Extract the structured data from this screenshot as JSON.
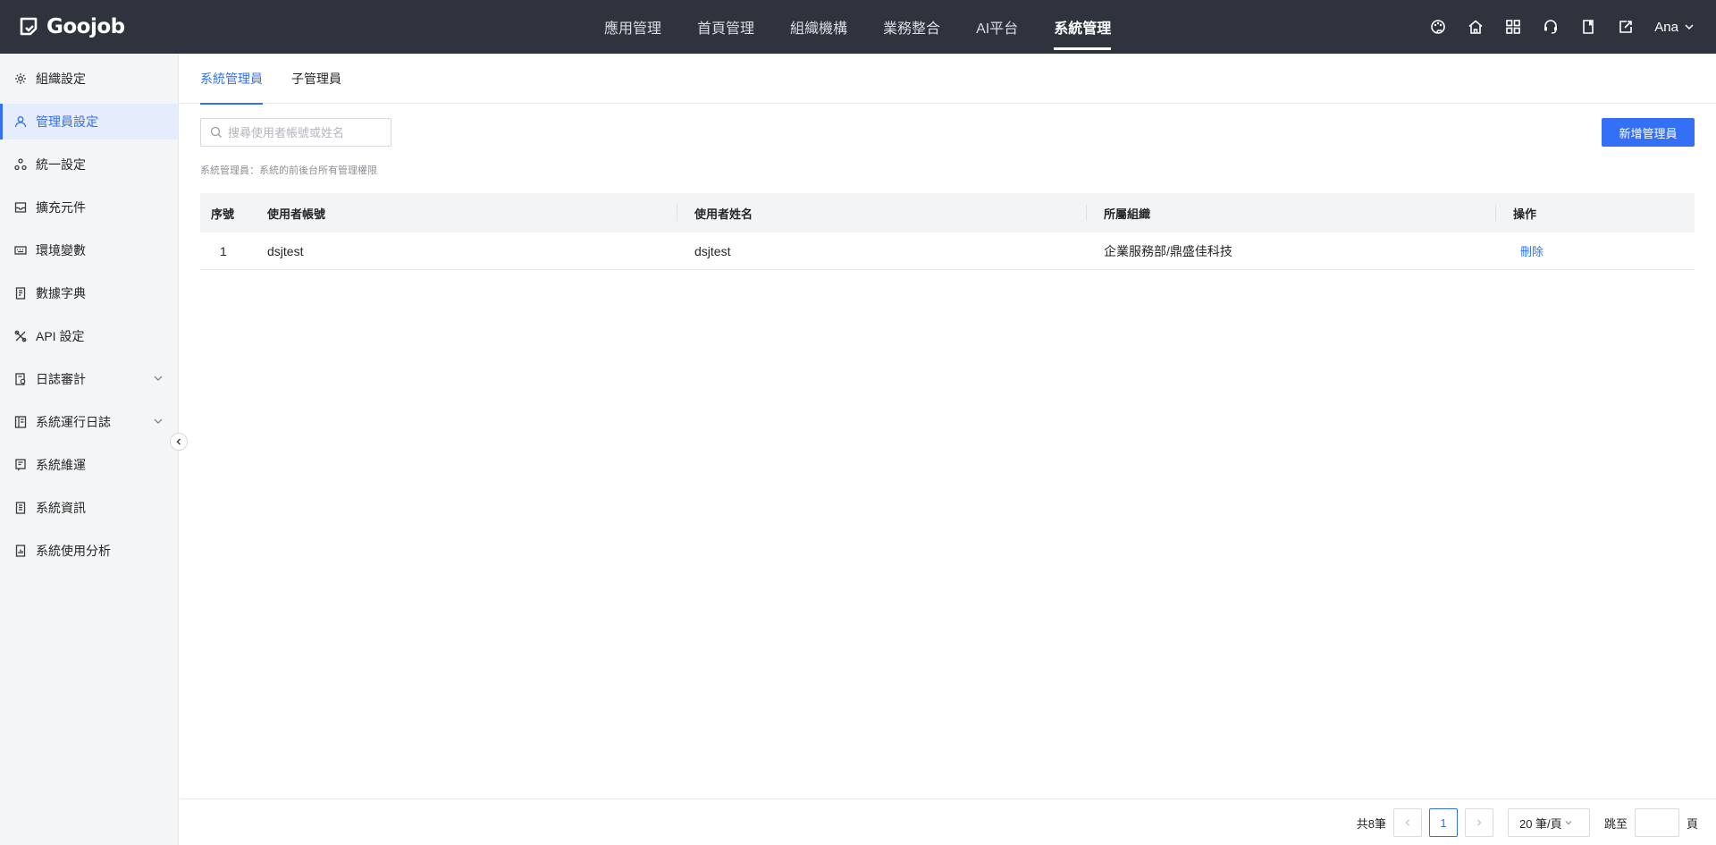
{
  "header": {
    "logo_text": "Goojob",
    "nav": [
      {
        "label": "應用管理",
        "active": false
      },
      {
        "label": "首頁管理",
        "active": false
      },
      {
        "label": "組織機構",
        "active": false
      },
      {
        "label": "業務整合",
        "active": false
      },
      {
        "label": "AI平台",
        "active": false
      },
      {
        "label": "系統管理",
        "active": true
      }
    ],
    "actions": [
      "palette-icon",
      "home-icon",
      "apps-grid-icon",
      "headset-icon",
      "book-icon",
      "export-icon"
    ],
    "user_name": "Ana"
  },
  "sidebar": {
    "items": [
      {
        "label": "組織設定",
        "icon": "gear-icon",
        "active": false,
        "expandable": false
      },
      {
        "label": "管理員設定",
        "icon": "user-icon",
        "active": true,
        "expandable": false
      },
      {
        "label": "統一設定",
        "icon": "cluster-icon",
        "active": false,
        "expandable": false
      },
      {
        "label": "擴充元件",
        "icon": "inbox-icon",
        "active": false,
        "expandable": false
      },
      {
        "label": "環境變數",
        "icon": "keyboard-icon",
        "active": false,
        "expandable": false
      },
      {
        "label": "數據字典",
        "icon": "doc-icon",
        "active": false,
        "expandable": false
      },
      {
        "label": "API 設定",
        "icon": "api-icon",
        "active": false,
        "expandable": false
      },
      {
        "label": "日誌審計",
        "icon": "audit-icon",
        "active": false,
        "expandable": true
      },
      {
        "label": "系統運行日誌",
        "icon": "log-icon",
        "active": false,
        "expandable": true
      },
      {
        "label": "系統維運",
        "icon": "ops-icon",
        "active": false,
        "expandable": false
      },
      {
        "label": "系統資訊",
        "icon": "info-doc-icon",
        "active": false,
        "expandable": false
      },
      {
        "label": "系統使用分析",
        "icon": "analysis-icon",
        "active": false,
        "expandable": false
      }
    ]
  },
  "tabs": [
    {
      "label": "系統管理員",
      "active": true
    },
    {
      "label": "子管理員",
      "active": false
    }
  ],
  "search": {
    "placeholder": "搜尋使用者帳號或姓名",
    "value": ""
  },
  "add_button_label": "新增管理員",
  "hint": "系統管理員：系統的前後台所有管理權限",
  "table": {
    "columns": [
      "序號",
      "使用者帳號",
      "使用者姓名",
      "所屬組織",
      "操作"
    ],
    "rows": [
      {
        "no": "1",
        "account": "dsjtest",
        "name": "dsjtest",
        "org": "企業服務部/鼎盛佳科技",
        "action": "刪除"
      }
    ]
  },
  "pagination": {
    "total_text": "共8筆",
    "current_page": "1",
    "page_size": "20 筆/頁",
    "jump_label": "跳至",
    "jump_suffix": "頁"
  },
  "colors": {
    "topbar": "#2f333d",
    "accent": "#3370f5",
    "sidebar": "#f4f5f7"
  }
}
